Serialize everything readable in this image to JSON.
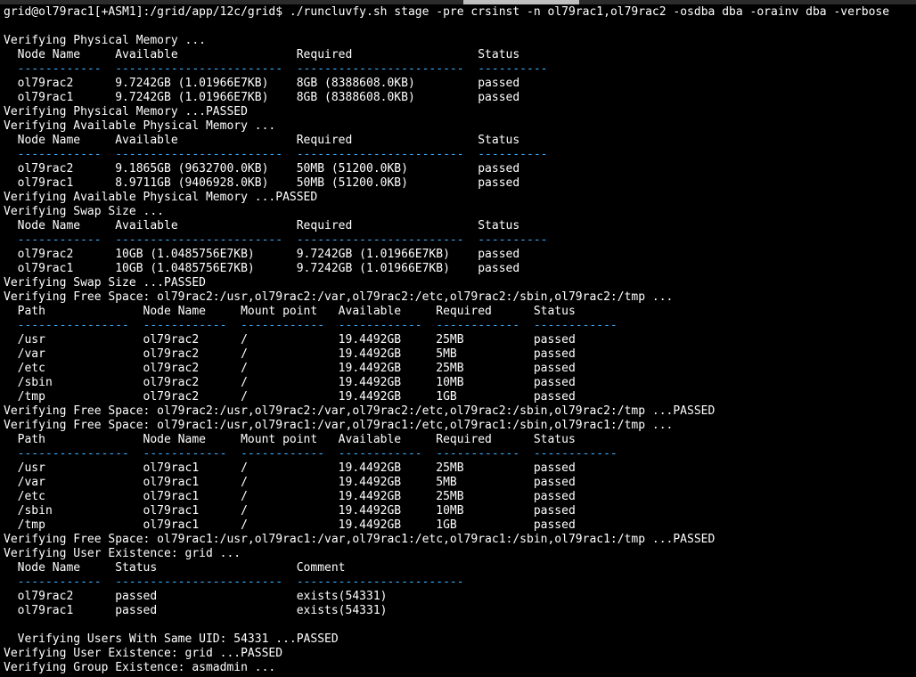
{
  "colors": {
    "background": "#000000",
    "text": "#ffffff",
    "option": "#3fb0ff",
    "rule": "#3fb0ff"
  },
  "command_line": [
    {
      "text": "grid@ol79rac1[+ASM1]:/grid/app/12c/grid$ ./runcluvfy.sh stage ",
      "kind": "text"
    },
    {
      "text": "-pre",
      "kind": "option"
    },
    {
      "text": " crsinst ",
      "kind": "text"
    },
    {
      "text": "-n",
      "kind": "option"
    },
    {
      "text": " ol79rac1,ol79rac2 ",
      "kind": "text"
    },
    {
      "text": "-osdba",
      "kind": "option"
    },
    {
      "text": " dba ",
      "kind": "text"
    },
    {
      "text": "-orainv",
      "kind": "option"
    },
    {
      "text": " dba ",
      "kind": "text"
    },
    {
      "text": "-verbose",
      "kind": "option"
    }
  ],
  "lines": [
    {
      "text": "",
      "kind": "text"
    },
    {
      "text": "Verifying Physical Memory ...",
      "kind": "text"
    },
    {
      "text": "  Node Name     Available                 Required                  Status",
      "kind": "text"
    },
    {
      "text": "  ------------  ------------------------  ------------------------  ----------",
      "kind": "rule"
    },
    {
      "text": "  ol79rac2      9.7242GB (1.01966E7KB)    8GB (8388608.0KB)         passed",
      "kind": "text"
    },
    {
      "text": "  ol79rac1      9.7242GB (1.01966E7KB)    8GB (8388608.0KB)         passed",
      "kind": "text"
    },
    {
      "text": "Verifying Physical Memory ...PASSED",
      "kind": "text"
    },
    {
      "text": "Verifying Available Physical Memory ...",
      "kind": "text"
    },
    {
      "text": "  Node Name     Available                 Required                  Status",
      "kind": "text"
    },
    {
      "text": "  ------------  ------------------------  ------------------------  ----------",
      "kind": "rule"
    },
    {
      "text": "  ol79rac2      9.1865GB (9632700.0KB)    50MB (51200.0KB)          passed",
      "kind": "text"
    },
    {
      "text": "  ol79rac1      8.9711GB (9406928.0KB)    50MB (51200.0KB)          passed",
      "kind": "text"
    },
    {
      "text": "Verifying Available Physical Memory ...PASSED",
      "kind": "text"
    },
    {
      "text": "Verifying Swap Size ...",
      "kind": "text"
    },
    {
      "text": "  Node Name     Available                 Required                  Status",
      "kind": "text"
    },
    {
      "text": "  ------------  ------------------------  ------------------------  ----------",
      "kind": "rule"
    },
    {
      "text": "  ol79rac2      10GB (1.0485756E7KB)      9.7242GB (1.01966E7KB)    passed",
      "kind": "text"
    },
    {
      "text": "  ol79rac1      10GB (1.0485756E7KB)      9.7242GB (1.01966E7KB)    passed",
      "kind": "text"
    },
    {
      "text": "Verifying Swap Size ...PASSED",
      "kind": "text"
    },
    {
      "text": "Verifying Free Space: ol79rac2:/usr,ol79rac2:/var,ol79rac2:/etc,ol79rac2:/sbin,ol79rac2:/tmp ...",
      "kind": "text"
    },
    {
      "text": "  Path              Node Name     Mount point   Available     Required      Status",
      "kind": "text"
    },
    {
      "text": "  ----------------  ------------  ------------  ------------  ------------  ------------",
      "kind": "rule"
    },
    {
      "text": "  /usr              ol79rac2      /             19.4492GB     25MB          passed",
      "kind": "text"
    },
    {
      "text": "  /var              ol79rac2      /             19.4492GB     5MB           passed",
      "kind": "text"
    },
    {
      "text": "  /etc              ol79rac2      /             19.4492GB     25MB          passed",
      "kind": "text"
    },
    {
      "text": "  /sbin             ol79rac2      /             19.4492GB     10MB          passed",
      "kind": "text"
    },
    {
      "text": "  /tmp              ol79rac2      /             19.4492GB     1GB           passed",
      "kind": "text"
    },
    {
      "text": "Verifying Free Space: ol79rac2:/usr,ol79rac2:/var,ol79rac2:/etc,ol79rac2:/sbin,ol79rac2:/tmp ...PASSED",
      "kind": "text"
    },
    {
      "text": "Verifying Free Space: ol79rac1:/usr,ol79rac1:/var,ol79rac1:/etc,ol79rac1:/sbin,ol79rac1:/tmp ...",
      "kind": "text"
    },
    {
      "text": "  Path              Node Name     Mount point   Available     Required      Status",
      "kind": "text"
    },
    {
      "text": "  ----------------  ------------  ------------  ------------  ------------  ------------",
      "kind": "rule"
    },
    {
      "text": "  /usr              ol79rac1      /             19.4492GB     25MB          passed",
      "kind": "text"
    },
    {
      "text": "  /var              ol79rac1      /             19.4492GB     5MB           passed",
      "kind": "text"
    },
    {
      "text": "  /etc              ol79rac1      /             19.4492GB     25MB          passed",
      "kind": "text"
    },
    {
      "text": "  /sbin             ol79rac1      /             19.4492GB     10MB          passed",
      "kind": "text"
    },
    {
      "text": "  /tmp              ol79rac1      /             19.4492GB     1GB           passed",
      "kind": "text"
    },
    {
      "text": "Verifying Free Space: ol79rac1:/usr,ol79rac1:/var,ol79rac1:/etc,ol79rac1:/sbin,ol79rac1:/tmp ...PASSED",
      "kind": "text"
    },
    {
      "text": "Verifying User Existence: grid ...",
      "kind": "text"
    },
    {
      "text": "  Node Name     Status                    Comment",
      "kind": "text"
    },
    {
      "text": "  ------------  ------------------------  ------------------------",
      "kind": "rule"
    },
    {
      "text": "  ol79rac2      passed                    exists(54331)",
      "kind": "text"
    },
    {
      "text": "  ol79rac1      passed                    exists(54331)",
      "kind": "text"
    },
    {
      "text": "",
      "kind": "text"
    },
    {
      "text": "  Verifying Users With Same UID: 54331 ...PASSED",
      "kind": "text"
    },
    {
      "text": "Verifying User Existence: grid ...PASSED",
      "kind": "text"
    },
    {
      "text": "Verifying Group Existence: asmadmin ...",
      "kind": "text"
    }
  ]
}
